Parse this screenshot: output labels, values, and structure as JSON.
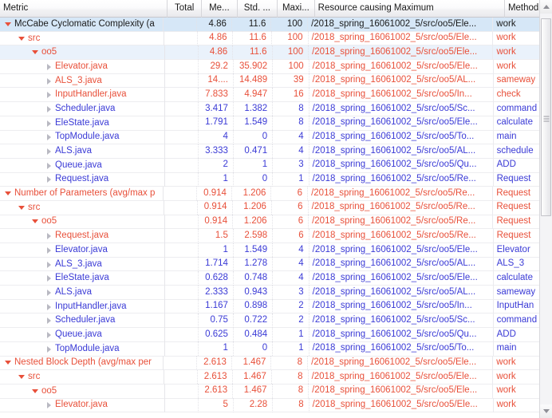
{
  "view": {
    "name": "metrics-tree-table",
    "scrollbar": {
      "up_arrow": "scroll-up",
      "down_arrow": "scroll-down"
    }
  },
  "columns": [
    {
      "key": "metric",
      "label": "Metric"
    },
    {
      "key": "total",
      "label": "Total"
    },
    {
      "key": "mean",
      "label": "Me..."
    },
    {
      "key": "std",
      "label": "Std. ..."
    },
    {
      "key": "maximum",
      "label": "Maxi..."
    },
    {
      "key": "resource",
      "label": "Resource causing Maximum"
    },
    {
      "key": "method",
      "label": "Method"
    }
  ],
  "rows": [
    {
      "label": "McCabe Cyclomatic Complexity (a",
      "indent": 0,
      "twisty": "open",
      "color": "dark",
      "selected": true,
      "total": "",
      "mean": "4.86",
      "std": "11.6",
      "maximum": "100",
      "resource": "/2018_spring_16061002_5/src/oo5/Ele...",
      "method": "work",
      "rcolor": "dark"
    },
    {
      "label": "src",
      "indent": 1,
      "twisty": "open",
      "color": "red",
      "selected": false,
      "total": "",
      "mean": "4.86",
      "std": "11.6",
      "maximum": "100",
      "resource": "/2018_spring_16061002_5/src/oo5/Ele...",
      "method": "work",
      "rcolor": "red"
    },
    {
      "label": "oo5",
      "indent": 2,
      "twisty": "open",
      "color": "red",
      "selected": true,
      "total": "",
      "mean": "4.86",
      "std": "11.6",
      "maximum": "100",
      "resource": "/2018_spring_16061002_5/src/oo5/Ele...",
      "method": "work",
      "rcolor": "red"
    },
    {
      "label": "Elevator.java",
      "indent": 3,
      "twisty": "closed",
      "color": "red",
      "selected": false,
      "total": "",
      "mean": "29.2",
      "std": "35.902",
      "maximum": "100",
      "resource": "/2018_spring_16061002_5/src/oo5/Ele...",
      "method": "work",
      "rcolor": "red"
    },
    {
      "label": "ALS_3.java",
      "indent": 3,
      "twisty": "closed",
      "color": "red",
      "selected": false,
      "total": "",
      "mean": "14....",
      "std": "14.489",
      "maximum": "39",
      "resource": "/2018_spring_16061002_5/src/oo5/AL...",
      "method": "sameway",
      "rcolor": "red"
    },
    {
      "label": "InputHandler.java",
      "indent": 3,
      "twisty": "closed",
      "color": "red",
      "selected": false,
      "total": "",
      "mean": "7.833",
      "std": "4.947",
      "maximum": "16",
      "resource": "/2018_spring_16061002_5/src/oo5/In...",
      "method": "check",
      "rcolor": "red"
    },
    {
      "label": "Scheduler.java",
      "indent": 3,
      "twisty": "closed",
      "color": "blue",
      "selected": false,
      "total": "",
      "mean": "3.417",
      "std": "1.382",
      "maximum": "8",
      "resource": "/2018_spring_16061002_5/src/oo5/Sc...",
      "method": "command",
      "rcolor": "blue"
    },
    {
      "label": "EleState.java",
      "indent": 3,
      "twisty": "closed",
      "color": "blue",
      "selected": false,
      "total": "",
      "mean": "1.791",
      "std": "1.549",
      "maximum": "8",
      "resource": "/2018_spring_16061002_5/src/oo5/Ele...",
      "method": "calculate",
      "rcolor": "blue"
    },
    {
      "label": "TopModule.java",
      "indent": 3,
      "twisty": "closed",
      "color": "blue",
      "selected": false,
      "total": "",
      "mean": "4",
      "std": "0",
      "maximum": "4",
      "resource": "/2018_spring_16061002_5/src/oo5/To...",
      "method": "main",
      "rcolor": "blue"
    },
    {
      "label": "ALS.java",
      "indent": 3,
      "twisty": "closed",
      "color": "blue",
      "selected": false,
      "total": "",
      "mean": "3.333",
      "std": "0.471",
      "maximum": "4",
      "resource": "/2018_spring_16061002_5/src/oo5/AL...",
      "method": "schedule",
      "rcolor": "blue"
    },
    {
      "label": "Queue.java",
      "indent": 3,
      "twisty": "closed",
      "color": "blue",
      "selected": false,
      "total": "",
      "mean": "2",
      "std": "1",
      "maximum": "3",
      "resource": "/2018_spring_16061002_5/src/oo5/Qu...",
      "method": "ADD",
      "rcolor": "blue"
    },
    {
      "label": "Request.java",
      "indent": 3,
      "twisty": "closed",
      "color": "blue",
      "selected": false,
      "total": "",
      "mean": "1",
      "std": "0",
      "maximum": "1",
      "resource": "/2018_spring_16061002_5/src/oo5/Re...",
      "method": "Request",
      "rcolor": "blue"
    },
    {
      "label": "Number of Parameters (avg/max p",
      "indent": 0,
      "twisty": "open",
      "color": "red",
      "selected": false,
      "total": "",
      "mean": "0.914",
      "std": "1.206",
      "maximum": "6",
      "resource": "/2018_spring_16061002_5/src/oo5/Re...",
      "method": "Request",
      "rcolor": "red"
    },
    {
      "label": "src",
      "indent": 1,
      "twisty": "open",
      "color": "red",
      "selected": false,
      "total": "",
      "mean": "0.914",
      "std": "1.206",
      "maximum": "6",
      "resource": "/2018_spring_16061002_5/src/oo5/Re...",
      "method": "Request",
      "rcolor": "red"
    },
    {
      "label": "oo5",
      "indent": 2,
      "twisty": "open",
      "color": "red",
      "selected": false,
      "total": "",
      "mean": "0.914",
      "std": "1.206",
      "maximum": "6",
      "resource": "/2018_spring_16061002_5/src/oo5/Re...",
      "method": "Request",
      "rcolor": "red"
    },
    {
      "label": "Request.java",
      "indent": 3,
      "twisty": "closed",
      "color": "red",
      "selected": false,
      "total": "",
      "mean": "1.5",
      "std": "2.598",
      "maximum": "6",
      "resource": "/2018_spring_16061002_5/src/oo5/Re...",
      "method": "Request",
      "rcolor": "red"
    },
    {
      "label": "Elevator.java",
      "indent": 3,
      "twisty": "closed",
      "color": "blue",
      "selected": false,
      "total": "",
      "mean": "1",
      "std": "1.549",
      "maximum": "4",
      "resource": "/2018_spring_16061002_5/src/oo5/Ele...",
      "method": "Elevator",
      "rcolor": "blue"
    },
    {
      "label": "ALS_3.java",
      "indent": 3,
      "twisty": "closed",
      "color": "blue",
      "selected": false,
      "total": "",
      "mean": "1.714",
      "std": "1.278",
      "maximum": "4",
      "resource": "/2018_spring_16061002_5/src/oo5/AL...",
      "method": "ALS_3",
      "rcolor": "blue"
    },
    {
      "label": "EleState.java",
      "indent": 3,
      "twisty": "closed",
      "color": "blue",
      "selected": false,
      "total": "",
      "mean": "0.628",
      "std": "0.748",
      "maximum": "4",
      "resource": "/2018_spring_16061002_5/src/oo5/Ele...",
      "method": "calculate",
      "rcolor": "blue"
    },
    {
      "label": "ALS.java",
      "indent": 3,
      "twisty": "closed",
      "color": "blue",
      "selected": false,
      "total": "",
      "mean": "2.333",
      "std": "0.943",
      "maximum": "3",
      "resource": "/2018_spring_16061002_5/src/oo5/AL...",
      "method": "sameway",
      "rcolor": "blue"
    },
    {
      "label": "InputHandler.java",
      "indent": 3,
      "twisty": "closed",
      "color": "blue",
      "selected": false,
      "total": "",
      "mean": "1.167",
      "std": "0.898",
      "maximum": "2",
      "resource": "/2018_spring_16061002_5/src/oo5/In...",
      "method": "InputHan",
      "rcolor": "blue"
    },
    {
      "label": "Scheduler.java",
      "indent": 3,
      "twisty": "closed",
      "color": "blue",
      "selected": false,
      "total": "",
      "mean": "0.75",
      "std": "0.722",
      "maximum": "2",
      "resource": "/2018_spring_16061002_5/src/oo5/Sc...",
      "method": "command",
      "rcolor": "blue"
    },
    {
      "label": "Queue.java",
      "indent": 3,
      "twisty": "closed",
      "color": "blue",
      "selected": false,
      "total": "",
      "mean": "0.625",
      "std": "0.484",
      "maximum": "1",
      "resource": "/2018_spring_16061002_5/src/oo5/Qu...",
      "method": "ADD",
      "rcolor": "blue"
    },
    {
      "label": "TopModule.java",
      "indent": 3,
      "twisty": "closed",
      "color": "blue",
      "selected": false,
      "total": "",
      "mean": "1",
      "std": "0",
      "maximum": "1",
      "resource": "/2018_spring_16061002_5/src/oo5/To...",
      "method": "main",
      "rcolor": "blue"
    },
    {
      "label": "Nested Block Depth (avg/max per",
      "indent": 0,
      "twisty": "open",
      "color": "red",
      "selected": false,
      "total": "",
      "mean": "2.613",
      "std": "1.467",
      "maximum": "8",
      "resource": "/2018_spring_16061002_5/src/oo5/Ele...",
      "method": "work",
      "rcolor": "red"
    },
    {
      "label": "src",
      "indent": 1,
      "twisty": "open",
      "color": "red",
      "selected": false,
      "total": "",
      "mean": "2.613",
      "std": "1.467",
      "maximum": "8",
      "resource": "/2018_spring_16061002_5/src/oo5/Ele...",
      "method": "work",
      "rcolor": "red"
    },
    {
      "label": "oo5",
      "indent": 2,
      "twisty": "open",
      "color": "red",
      "selected": false,
      "total": "",
      "mean": "2.613",
      "std": "1.467",
      "maximum": "8",
      "resource": "/2018_spring_16061002_5/src/oo5/Ele...",
      "method": "work",
      "rcolor": "red"
    },
    {
      "label": "Elevator.java",
      "indent": 3,
      "twisty": "closed",
      "color": "red",
      "selected": false,
      "total": "",
      "mean": "5",
      "std": "2.28",
      "maximum": "8",
      "resource": "/2018_spring_16061002_5/src/oo5/Ele...",
      "method": "work",
      "rcolor": "red"
    }
  ]
}
